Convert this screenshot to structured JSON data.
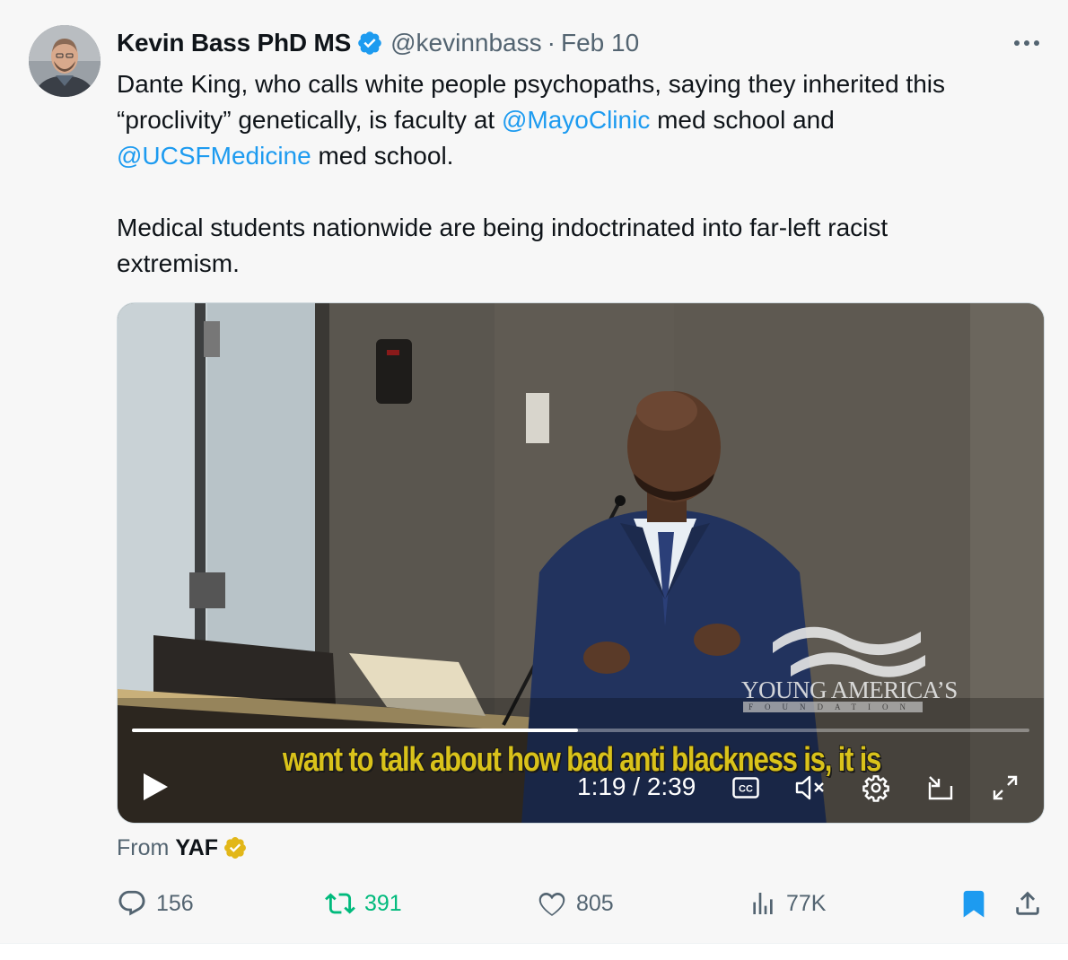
{
  "tweet": {
    "author": {
      "name": "Kevin Bass PhD MS",
      "handle": "@kevinnbass",
      "separator": "·",
      "date": "Feb 10",
      "verified_color": "#1d9bf0"
    },
    "more_label": "•••",
    "text": {
      "line1": "Dante King, who calls white people psychopaths, saying they inherited this",
      "line2_pre": "“proclivity” genetically, is faculty at ",
      "mention1": "@MayoClinic",
      "line2_post": " med school and",
      "mention2": "@UCSFMedicine",
      "line3_post": " med school.",
      "line4": "Medical students nationwide are being indoctrinated into far-left racist",
      "line5": "extremism."
    },
    "media": {
      "watermark_name": "YOUNG AMERICA’S",
      "watermark_sub": "FOUNDATION",
      "caption": "want to talk about how bad anti blackness is, it is",
      "time_display": "1:19 / 2:39",
      "progress": 0.497,
      "cc_label": "CC"
    },
    "source": {
      "prefix": "From",
      "name": "YAF",
      "badge_color": "#e2b719"
    },
    "actions": {
      "replies": "156",
      "retweets": "391",
      "likes": "805",
      "views": "77K"
    },
    "colors": {
      "link": "#1d9bf0",
      "retweet": "#00ba7c",
      "muted": "#536471",
      "bookmark": "#1d9bf0"
    }
  }
}
